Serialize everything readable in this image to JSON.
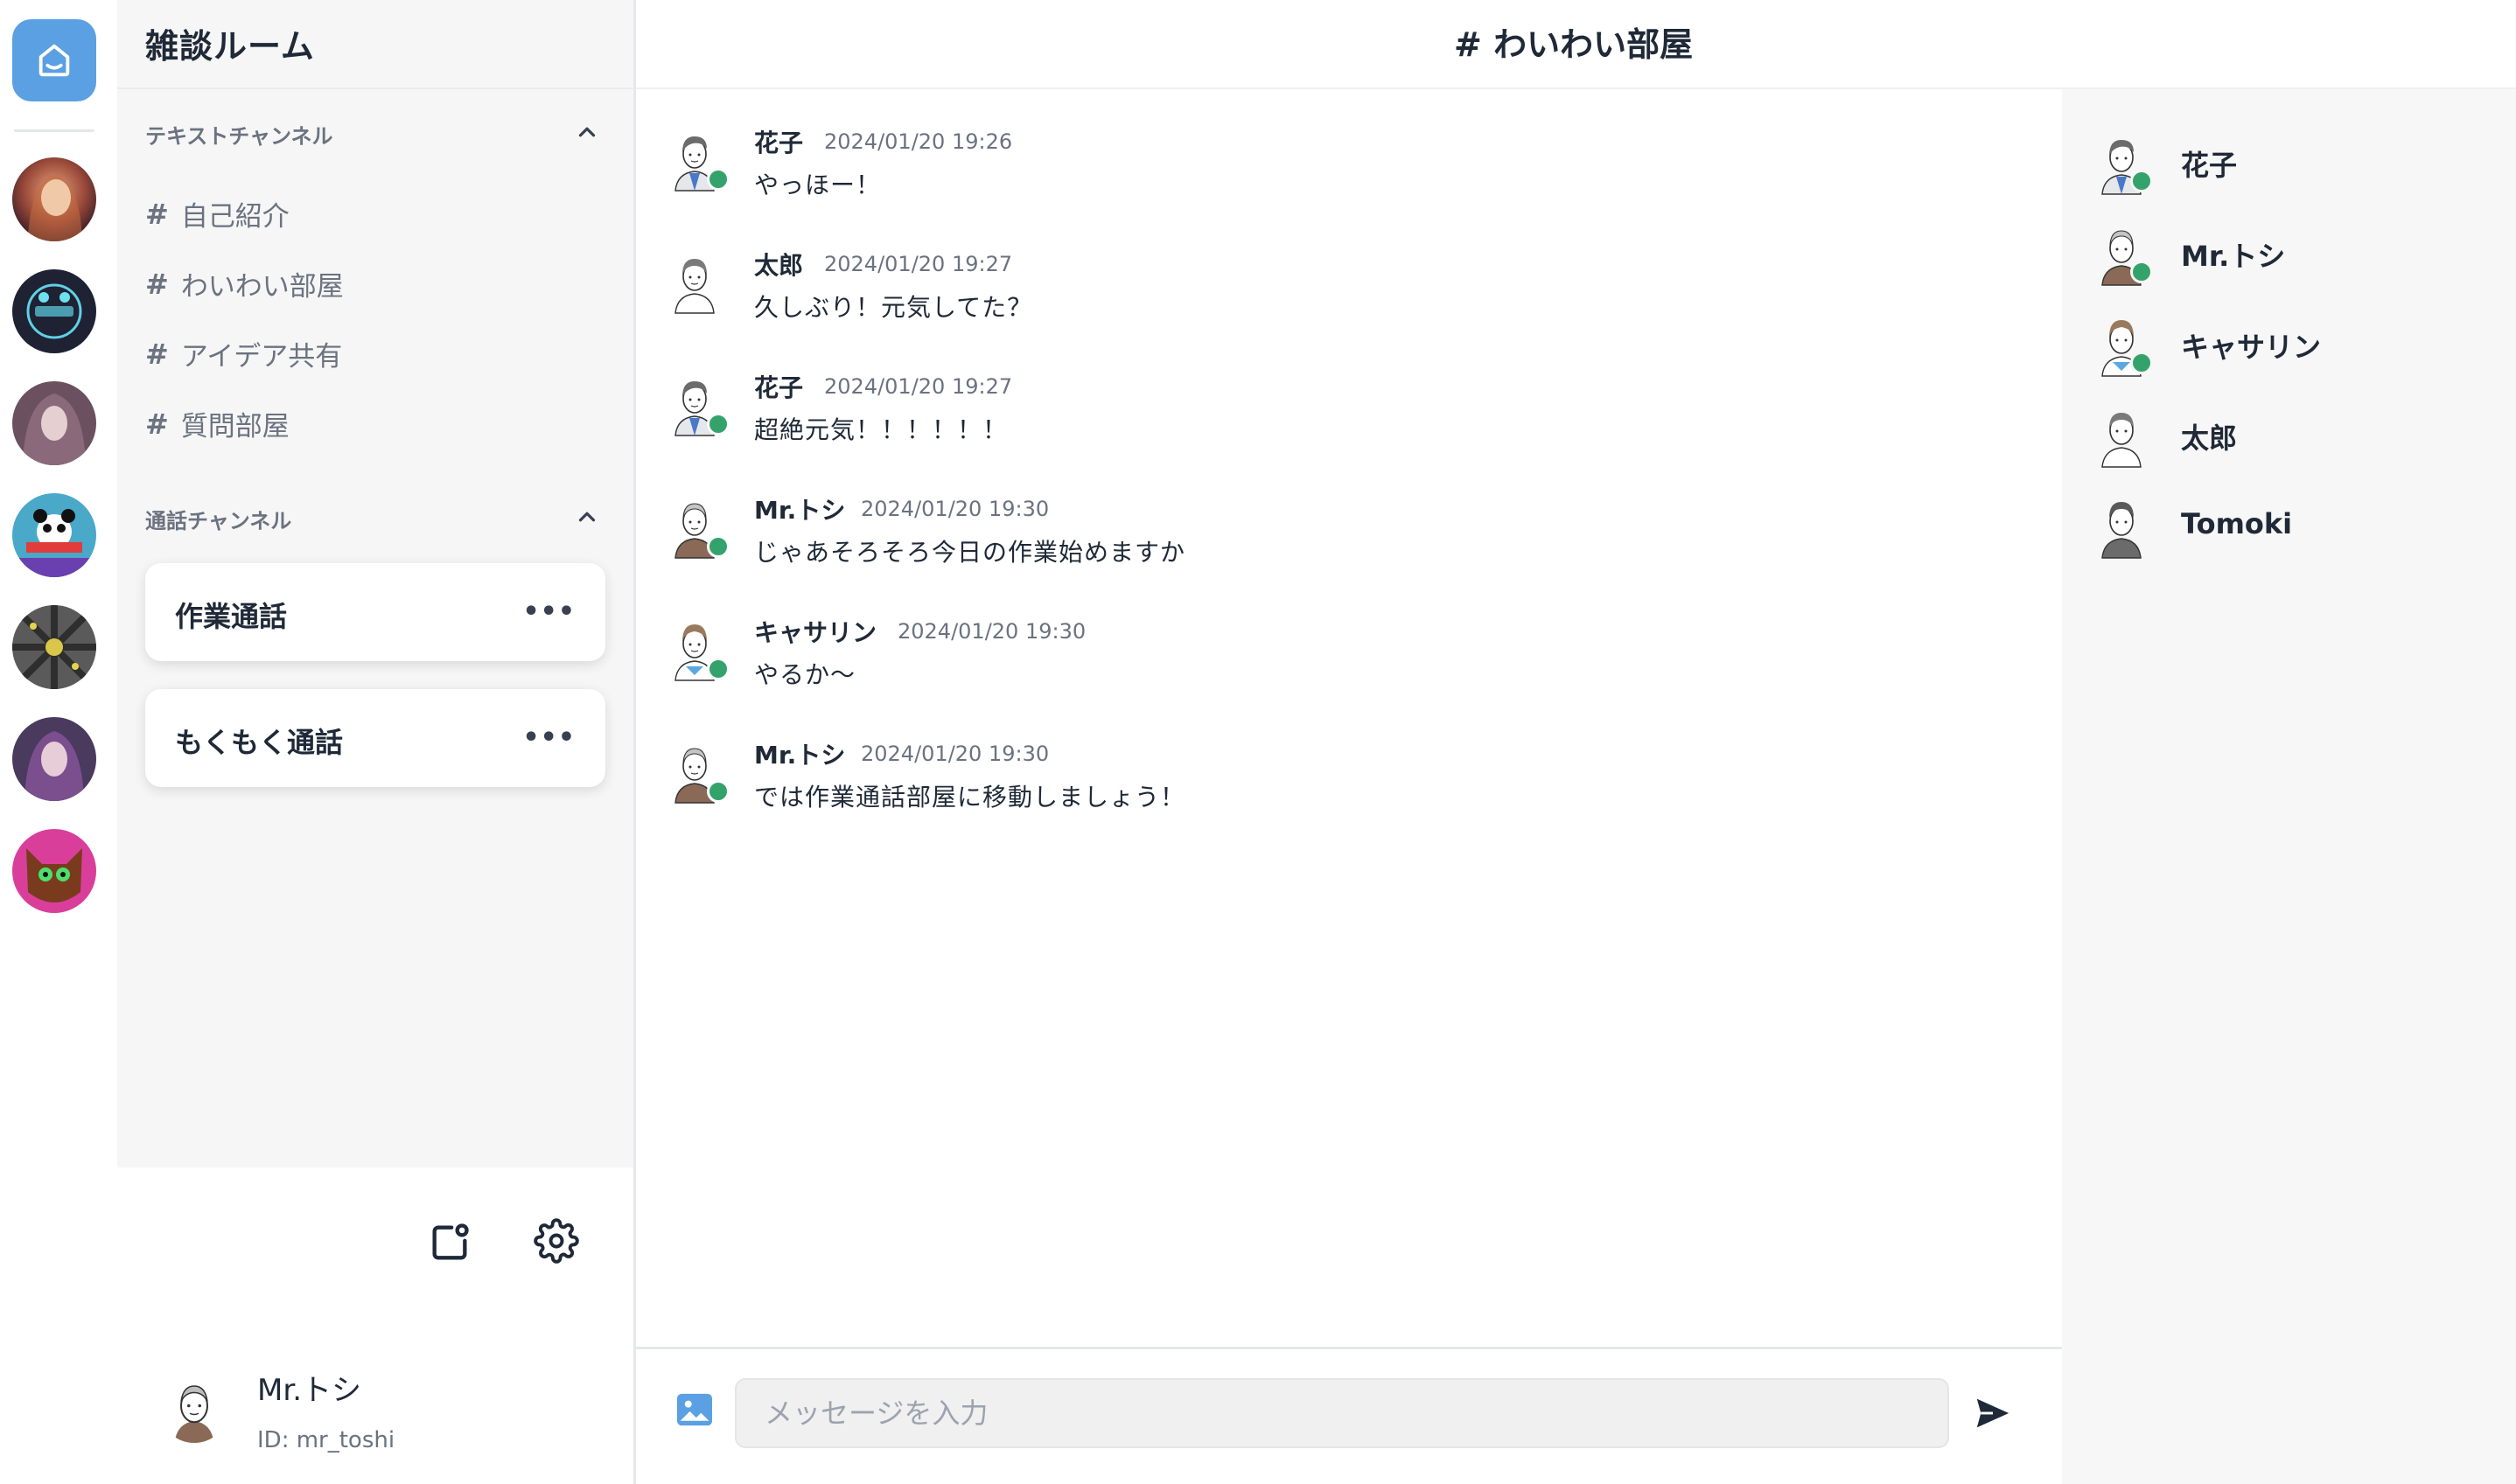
{
  "room": {
    "title": "雑談ルーム"
  },
  "text_channels": {
    "header": "テキストチャンネル",
    "items": [
      {
        "hash": "#",
        "label": "自己紹介"
      },
      {
        "hash": "#",
        "label": "わいわい部屋"
      },
      {
        "hash": "#",
        "label": "アイデア共有"
      },
      {
        "hash": "#",
        "label": "質問部屋"
      }
    ]
  },
  "voice_channels": {
    "header": "通話チャンネル",
    "items": [
      {
        "label": "作業通話",
        "more": "•••"
      },
      {
        "label": "もくもく通話",
        "more": "•••"
      }
    ]
  },
  "current_user": {
    "name": "Mr.トシ",
    "id": "ID: mr_toshi"
  },
  "chat": {
    "title": "# わいわい部屋"
  },
  "messages": [
    {
      "author": "花子",
      "time": "2024/01/20 19:26",
      "text": "やっほー！",
      "online": true
    },
    {
      "author": "太郎",
      "time": "2024/01/20 19:27",
      "text": "久しぶり！元気してた？",
      "online": false
    },
    {
      "author": "花子",
      "time": "2024/01/20 19:27",
      "text": "超絶元気！！！！！！",
      "online": true
    },
    {
      "author": "Mr.トシ",
      "time": "2024/01/20 19:30",
      "text": "じゃあそろそろ今日の作業始めますか",
      "online": true
    },
    {
      "author": "キャサリン",
      "time": "2024/01/20 19:30",
      "text": "やるか〜",
      "online": true
    },
    {
      "author": "Mr.トシ",
      "time": "2024/01/20 19:30",
      "text": "では作業通話部屋に移動しましょう！",
      "online": true
    }
  ],
  "composer": {
    "placeholder": "メッセージを入力"
  },
  "members": [
    {
      "name": "花子",
      "online": true
    },
    {
      "name": "Mr.トシ",
      "online": true
    },
    {
      "name": "キャサリン",
      "online": true
    },
    {
      "name": "太郎",
      "online": false
    },
    {
      "name": "Tomoki",
      "online": false
    }
  ],
  "colors": {
    "accent": "#5aa0e3",
    "online": "#34a36b",
    "sidebar_bg": "#f6f6f6"
  },
  "icons": {
    "home": "home-icon",
    "chevron": "chevron-up-icon",
    "more": "more-horizontal-icon",
    "new_window": "new-channel-icon",
    "settings": "gear-icon",
    "image": "image-icon",
    "send": "send-icon"
  }
}
